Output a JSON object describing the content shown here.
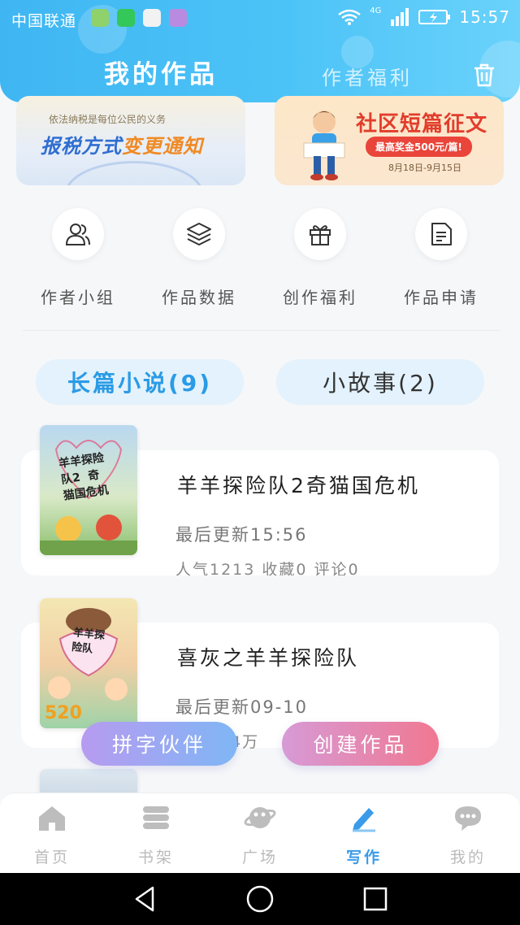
{
  "status_bar": {
    "carrier": "中国联通",
    "network": "4G",
    "time": "15:57"
  },
  "header": {
    "tab_active": "我的作品",
    "tab_inactive": "作者福利",
    "trash_icon": "trash-icon"
  },
  "banners": {
    "left": {
      "small_text": "依法纳税是每位公民的义务",
      "title_part1": "报税方式",
      "title_part2": "变更通知"
    },
    "right": {
      "title": "社区短篇征文",
      "pill": "最高奖金500元/篇!",
      "date": "8月18日-9月15日"
    }
  },
  "quick_actions": [
    {
      "label": "作者小组",
      "icon": "users-icon"
    },
    {
      "label": "作品数据",
      "icon": "layers-icon"
    },
    {
      "label": "创作福利",
      "icon": "gift-icon"
    },
    {
      "label": "作品申请",
      "icon": "document-icon"
    }
  ],
  "type_tabs": {
    "active": "长篇小说(9)",
    "inactive": "小故事(2)"
  },
  "works": [
    {
      "title": "羊羊探险队2奇猫国危机",
      "updated": "最后更新15:56",
      "stats": "人气1213  收藏0  评论0",
      "cover_text": "羊羊探险\n队2  奇\n猫国危机"
    },
    {
      "title": "喜灰之羊羊探险队",
      "updated": "最后更新09-10",
      "stats": "4万",
      "cover_text": "羊羊探\n险队"
    }
  ],
  "fabs": {
    "left": "拼字伙伴",
    "right": "创建作品"
  },
  "bottom_nav": [
    {
      "label": "首页",
      "icon": "home-icon",
      "active": false
    },
    {
      "label": "书架",
      "icon": "bookshelf-icon",
      "active": false
    },
    {
      "label": "广场",
      "icon": "planet-icon",
      "active": false
    },
    {
      "label": "写作",
      "icon": "pen-icon",
      "active": true
    },
    {
      "label": "我的",
      "icon": "chat-bubble-icon",
      "active": false
    }
  ],
  "colors": {
    "header": "#4cc3f7",
    "accent": "#2a9be6",
    "fab_left": "#9aa8f3",
    "fab_right": "#e58aab"
  }
}
